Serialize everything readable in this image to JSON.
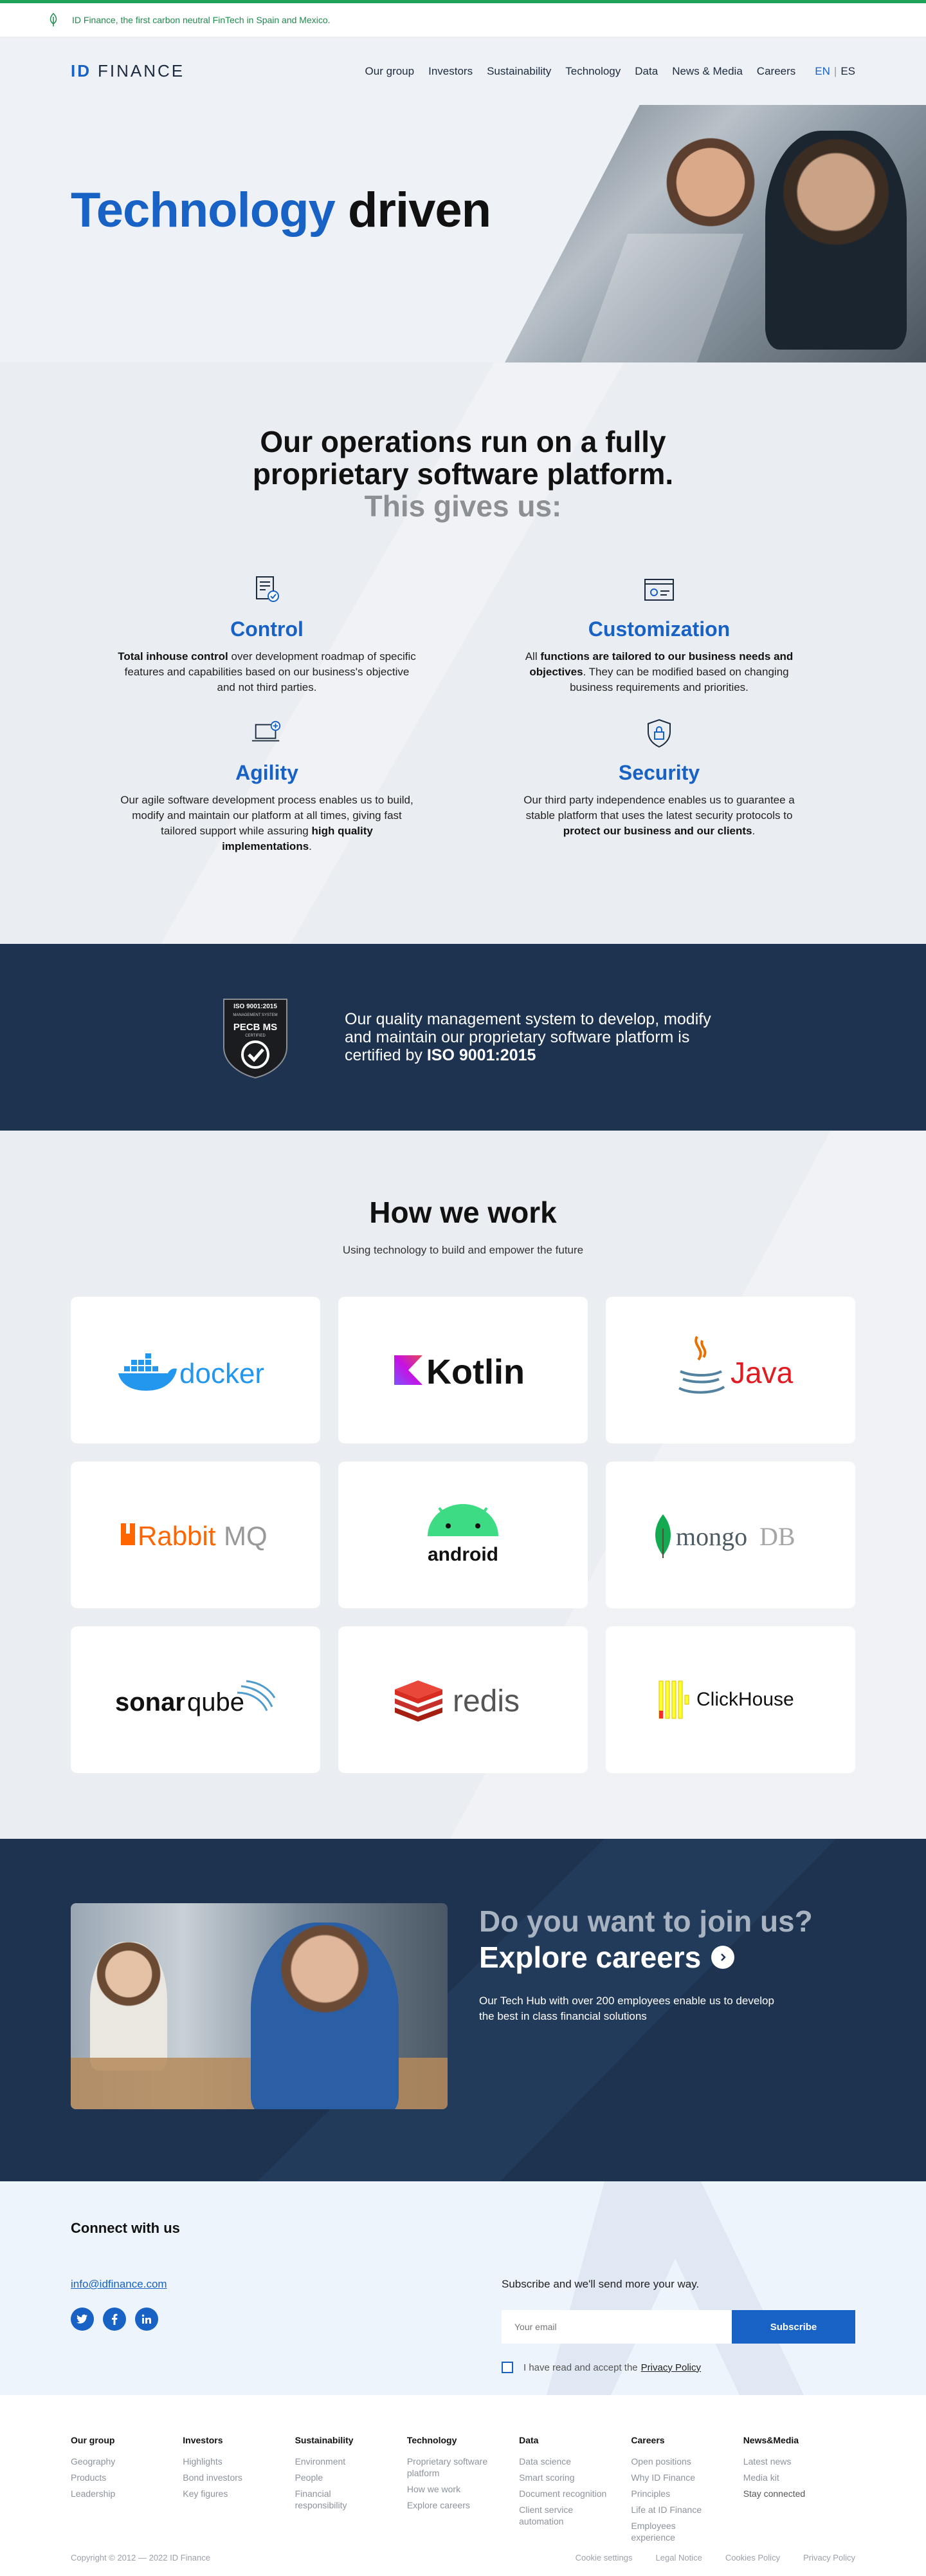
{
  "banner": {
    "text": "ID Finance, the first carbon neutral FinTech in Spain and Mexico.",
    "icon": "leaf-icon",
    "color": "#1f8a4c"
  },
  "header": {
    "logo_id": "ID",
    "logo_name": "FINANCE",
    "nav": [
      "Our group",
      "Investors",
      "Sustainability",
      "Technology",
      "Data",
      "News & Media",
      "Careers"
    ],
    "lang_en": "EN",
    "lang_sep": "|",
    "lang_es": "ES"
  },
  "hero": {
    "title_blue": "Technology",
    "title_dark": "driven"
  },
  "features": {
    "heading_line1": "Our operations run on a fully",
    "heading_line2": "proprietary software platform.",
    "heading_line3": "This gives us:",
    "items": [
      {
        "icon": "document-check-icon",
        "title": "Control",
        "bold1": "Total inhouse control",
        "text1": " over development roadmap of specific features and capabilities based on our business's objective and not third parties.",
        "text2": "",
        "bold2": ""
      },
      {
        "icon": "browser-settings-icon",
        "title": "Customization",
        "text1": "All ",
        "bold1": "functions are tailored to our business needs and objectives",
        "text2": ". They can be modified based on changing business requirements and priorities.",
        "bold2": ""
      },
      {
        "icon": "laptop-icon",
        "title": "Agility",
        "text1": "Our agile software development process enables us to build, modify and maintain our platform at all times, giving fast tailored support while assuring ",
        "bold1": "high quality implementations",
        "text2": ".",
        "bold2": ""
      },
      {
        "icon": "shield-lock-icon",
        "title": "Security",
        "text1": "Our third party independence enables us to guarantee a stable platform that uses the latest security protocols to ",
        "bold1": "protect our business and our clients",
        "text2": ".",
        "bold2": ""
      }
    ]
  },
  "iso": {
    "badge_line1": "ISO 9001:2015",
    "badge_line2": "MANAGEMENT SYSTEM",
    "badge_line3": "PECB MS",
    "badge_line4": "CERTIFIED",
    "text": "Our quality management system to develop, modify and maintain our proprietary software platform is certified by ",
    "text_bold": "ISO 9001:2015"
  },
  "how": {
    "title": "How we work",
    "subtitle": "Using technology to build and empower the future",
    "logos": [
      "docker",
      "Kotlin",
      "Java",
      "RabbitMQ",
      "android",
      "mongoDB",
      "sonarqube",
      "redis",
      "ClickHouse"
    ]
  },
  "careers": {
    "question": "Do you want to join us?",
    "cta": "Explore careers",
    "text": "Our Tech Hub with over 200 employees enable us to develop the best in class financial solutions"
  },
  "connect": {
    "title": "Connect with us",
    "email": "info@idfinance.com",
    "socials": [
      "twitter-icon",
      "facebook-icon",
      "linkedin-icon"
    ],
    "subscribe_title": "Subscribe and we'll send more your way.",
    "email_placeholder": "Your email",
    "subscribe_button": "Subscribe",
    "consent_text": "I have read and accept the",
    "consent_link": "Privacy Policy"
  },
  "footer": {
    "columns": [
      {
        "title": "Our group",
        "links": [
          "Geography",
          "Products",
          "Leadership"
        ]
      },
      {
        "title": "Investors",
        "links": [
          "Highlights",
          "Bond investors",
          "Key figures"
        ]
      },
      {
        "title": "Sustainability",
        "links": [
          "Environment",
          "People",
          "Financial responsibility"
        ]
      },
      {
        "title": "Technology",
        "links": [
          "Proprietary software platform",
          "How we work",
          "Explore careers"
        ]
      },
      {
        "title": "Data",
        "links": [
          "Data science",
          "Smart scoring",
          "Document recognition",
          "Client service automation"
        ]
      },
      {
        "title": "Careers",
        "links": [
          "Open positions",
          "Why ID Finance",
          "Principles",
          "Life at ID Finance",
          "Employees experience"
        ]
      },
      {
        "title": "News&Media",
        "links": [
          "Latest news",
          "Media kit",
          "Stay connected"
        ]
      }
    ],
    "copyright": "Copyright © 2012 — 2022 ID Finance",
    "bottom_links": [
      "Cookie settings",
      "Legal Notice",
      "Cookies Policy",
      "Privacy Policy"
    ]
  },
  "colors": {
    "accent": "#1762c4",
    "navy": "#1d3350",
    "green": "#20a25a"
  }
}
